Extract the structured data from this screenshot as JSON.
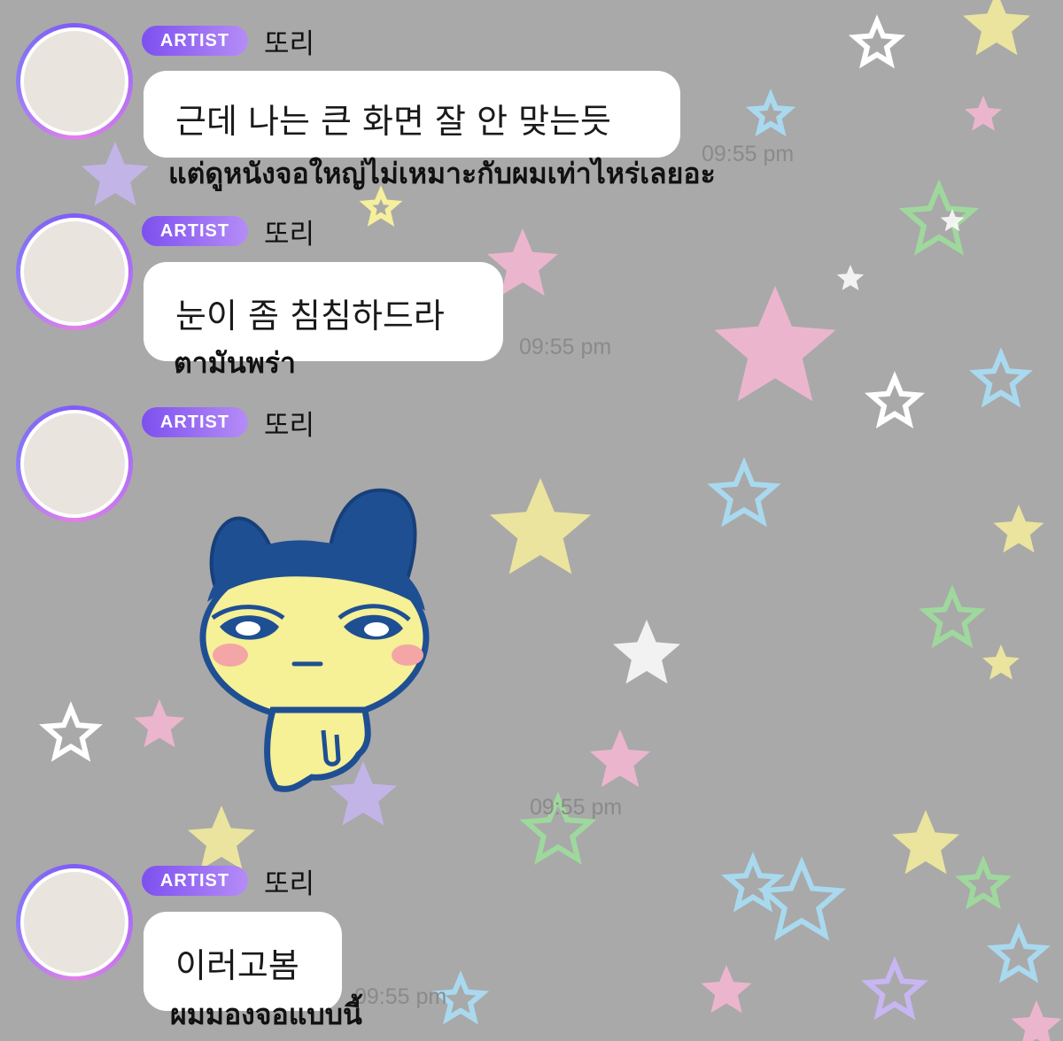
{
  "theme": {
    "background": "#a9a9a9",
    "badge_gradient": [
      "#7d50f0",
      "#b58cf6"
    ],
    "avatar_ring": [
      "#7f5cf6",
      "#e080e8"
    ],
    "star_colors": [
      "#f7b9d4",
      "#f6ef9c",
      "#9fd89d",
      "#a9d9ef",
      "#c8b6f3",
      "#ffffff"
    ]
  },
  "messages": [
    {
      "badge": "ARTIST",
      "sender": "또리",
      "text": "근데 나는 큰 화면 잘 안 맞는듯",
      "time": "09:55 pm",
      "caption": "แต่ดูหนังจอใหญ่ไม่เหมาะกับผมเท่าไหร่เลยอะ"
    },
    {
      "badge": "ARTIST",
      "sender": "또리",
      "text": "눈이 좀 침침하드라",
      "time": "09:55 pm",
      "caption": "ตามันพร่า"
    },
    {
      "badge": "ARTIST",
      "sender": "또리",
      "sticker": "mametchi-sticker",
      "time": "09:55 pm"
    },
    {
      "badge": "ARTIST",
      "sender": "또리",
      "text": "이러고봄",
      "time": "09:55 pm",
      "caption": "ผมมองจอแบบนี้"
    }
  ]
}
